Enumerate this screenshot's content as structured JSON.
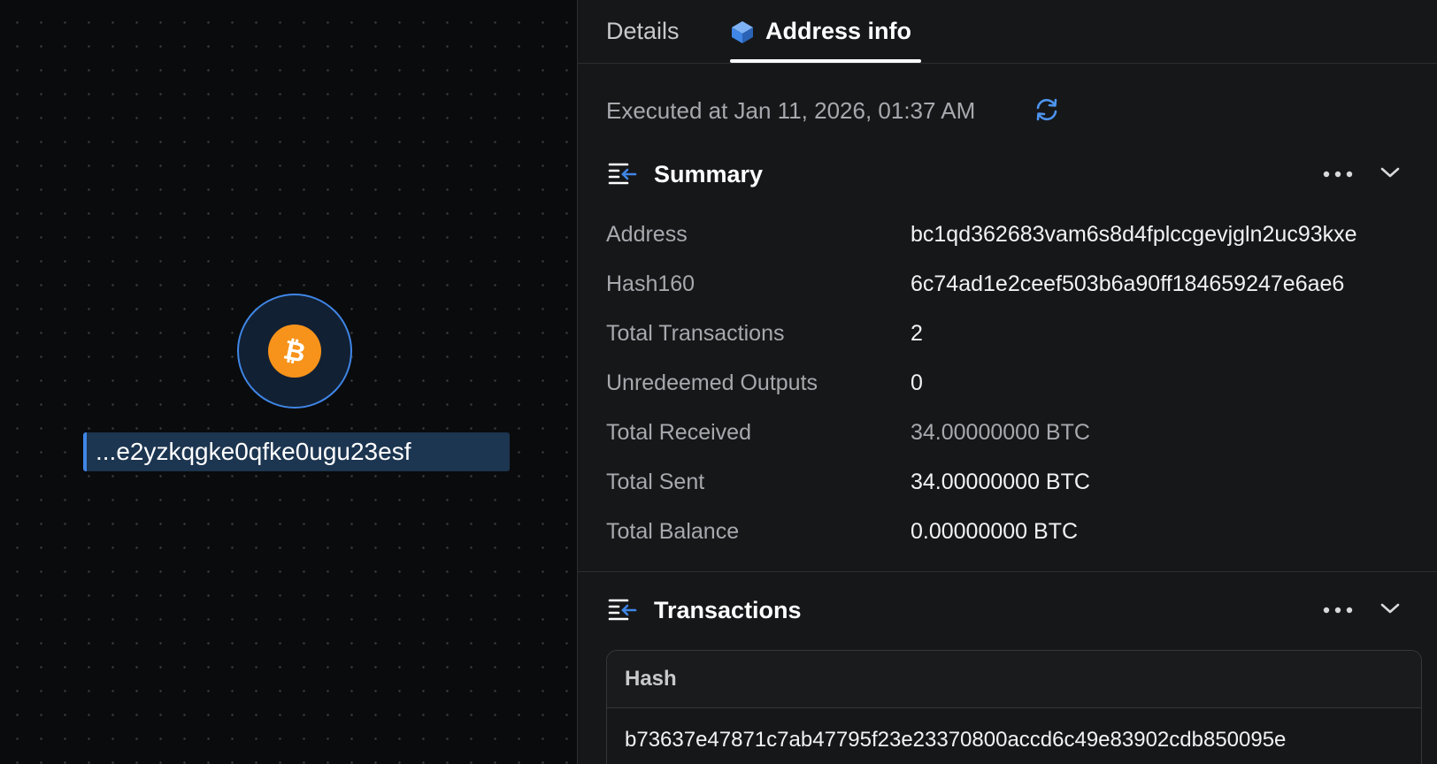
{
  "canvas": {
    "node": {
      "icon": "bitcoin-icon",
      "label": "...e2yzkqgke0qfke0ugu23esf"
    }
  },
  "tabs": [
    {
      "label": "Details",
      "active": false
    },
    {
      "label": "Address info",
      "active": true,
      "icon": "cube-icon"
    }
  ],
  "executed_text": "Executed at Jan 11, 2026, 01:37 AM",
  "summary": {
    "title": "Summary",
    "rows": [
      {
        "key": "Address",
        "value": "bc1qd362683vam6s8d4fplccgevjgln2uc93kxe"
      },
      {
        "key": "Hash160",
        "value": "6c74ad1e2ceef503b6a90ff184659247e6ae6"
      },
      {
        "key": "Total Transactions",
        "value": "2"
      },
      {
        "key": "Unredeemed Outputs",
        "value": "0"
      },
      {
        "key": "Total Received",
        "value": "34.00000000 BTC"
      },
      {
        "key": "Total Sent",
        "value": "34.00000000 BTC"
      },
      {
        "key": "Total Balance",
        "value": "0.00000000 BTC"
      }
    ]
  },
  "transactions": {
    "title": "Transactions",
    "columns": [
      "Hash"
    ],
    "rows": [
      {
        "hash": "b73637e47871c7ab47795f23e23370800accd6c49e83902cdb850095e"
      }
    ]
  },
  "colors": {
    "accent": "#3f86e6",
    "bitcoin": "#f7931a",
    "panel_bg": "#161719",
    "canvas_bg": "#0a0b0c"
  }
}
